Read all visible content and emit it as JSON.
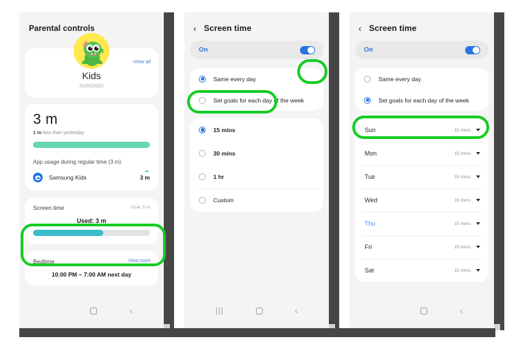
{
  "annotations": {
    "highlight_color": "#15cc24",
    "rings": [
      {
        "name": "screen-time-card",
        "phone": 1
      },
      {
        "name": "on-toggle",
        "phone": 2
      },
      {
        "name": "same-every-day-option",
        "phone": 2
      },
      {
        "name": "set-goals-option",
        "phone": 3
      }
    ]
  },
  "phone1": {
    "page_title": "Parental controls",
    "kid_card": {
      "view_all_label": "View all",
      "name": "Kids",
      "date": "01/01/2022",
      "avatar_icon": "dinosaur-avatar-icon"
    },
    "usage_card": {
      "total": "3 m",
      "delta_value": "1 m",
      "delta_text": " less than yesterday",
      "progress_percent": 100,
      "progress_color": "#63d7b2",
      "app_section_header": "App usage during regular time (3 m)",
      "apps": [
        {
          "icon": "samsung-kids-icon",
          "name": "Samsung Kids",
          "time": "3 m"
        }
      ]
    },
    "screen_time_card": {
      "title": "Screen time",
      "goal": "Goal: 5 m",
      "used": "Used: 3 m",
      "progress_percent": 60,
      "progress_color": "#3bbcc9"
    },
    "bedtime_card": {
      "title": "Bedtime",
      "view_more_label": "View more",
      "schedule": "10:00 PM ~ 7:00 AM next day"
    },
    "navbar": {
      "recents": "",
      "home": "home-icon",
      "back": "‹"
    }
  },
  "phone2": {
    "header": {
      "back_icon": "‹",
      "title": "Screen time"
    },
    "toggle": {
      "label": "On",
      "state": "on",
      "accent": "#2a74e0"
    },
    "mode_options": [
      {
        "label": "Same every day",
        "selected": true
      },
      {
        "label": "Set goals for each day of the week",
        "selected": false
      }
    ],
    "duration_options": [
      {
        "label": "15 mins",
        "selected": true,
        "bold": true
      },
      {
        "label": "30 mins",
        "selected": false,
        "bold": true
      },
      {
        "label": "1 hr",
        "selected": false,
        "bold": true
      },
      {
        "label": "Custom",
        "selected": false,
        "bold": false
      }
    ],
    "navbar": {
      "recents": "|||",
      "home": "home-icon",
      "back": "‹"
    }
  },
  "phone3": {
    "header": {
      "back_icon": "‹",
      "title": "Screen time"
    },
    "toggle": {
      "label": "On",
      "state": "on",
      "accent": "#2a74e0"
    },
    "mode_options": [
      {
        "label": "Same every day",
        "selected": false
      },
      {
        "label": "Set goals for each day of the week",
        "selected": true
      }
    ],
    "days": [
      {
        "name": "Sun",
        "value": "15 mins",
        "today": false
      },
      {
        "name": "Mon",
        "value": "15 mins",
        "today": false
      },
      {
        "name": "Tue",
        "value": "15 mins",
        "today": false
      },
      {
        "name": "Wed",
        "value": "15 mins",
        "today": false
      },
      {
        "name": "Thu",
        "value": "15 mins",
        "today": true
      },
      {
        "name": "Fri",
        "value": "15 mins",
        "today": false
      },
      {
        "name": "Sat",
        "value": "15 mins",
        "today": false
      }
    ],
    "navbar": {
      "recents": "",
      "home": "home-icon",
      "back": "‹"
    }
  }
}
